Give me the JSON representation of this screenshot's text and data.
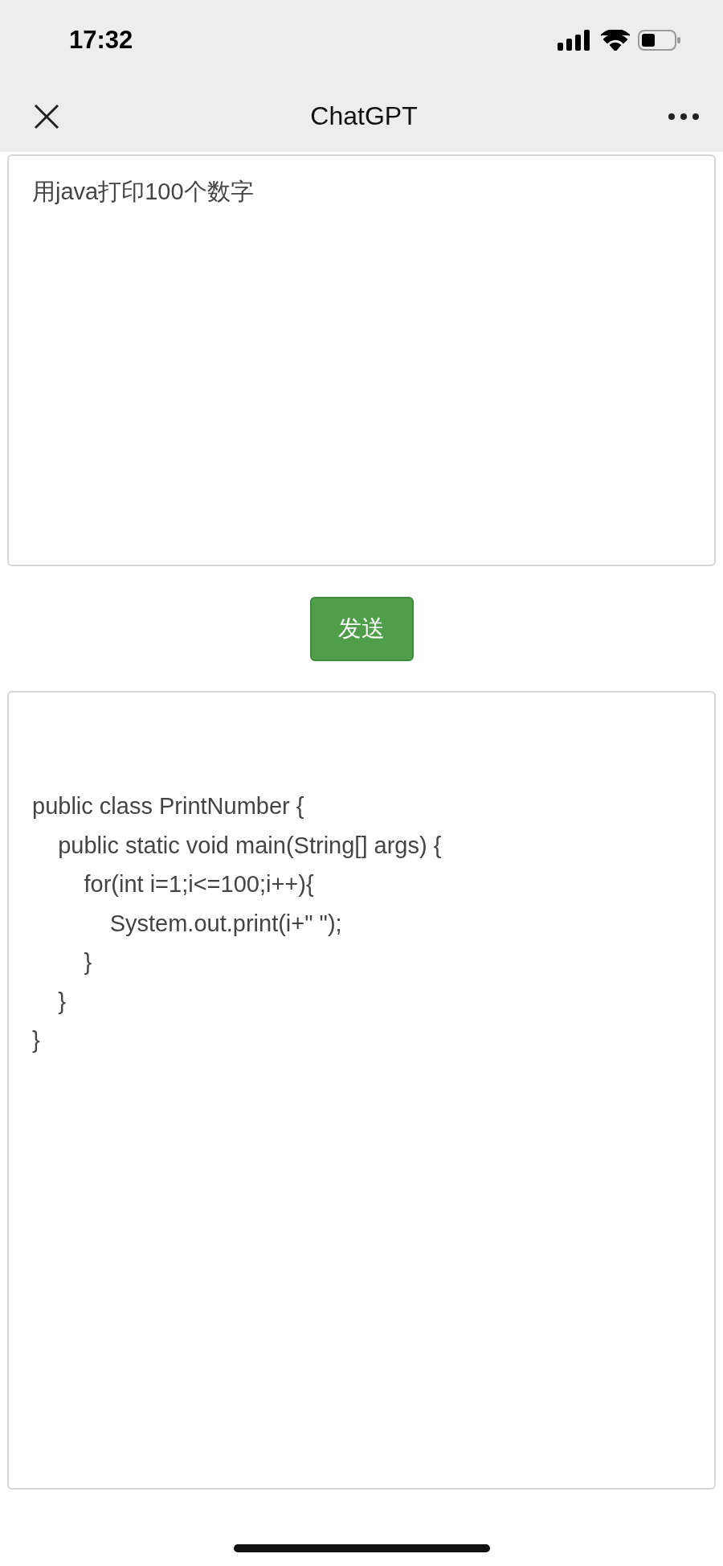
{
  "status_bar": {
    "time": "17:32"
  },
  "nav_bar": {
    "title": "ChatGPT"
  },
  "prompt": {
    "value": "用java打印100个数字"
  },
  "send_button": {
    "label": "发送"
  },
  "output": {
    "value": "\n\npublic class PrintNumber {\n    public static void main(String[] args) {\n        for(int i=1;i<=100;i++){\n            System.out.print(i+\" \");\n        }\n    }\n}"
  }
}
